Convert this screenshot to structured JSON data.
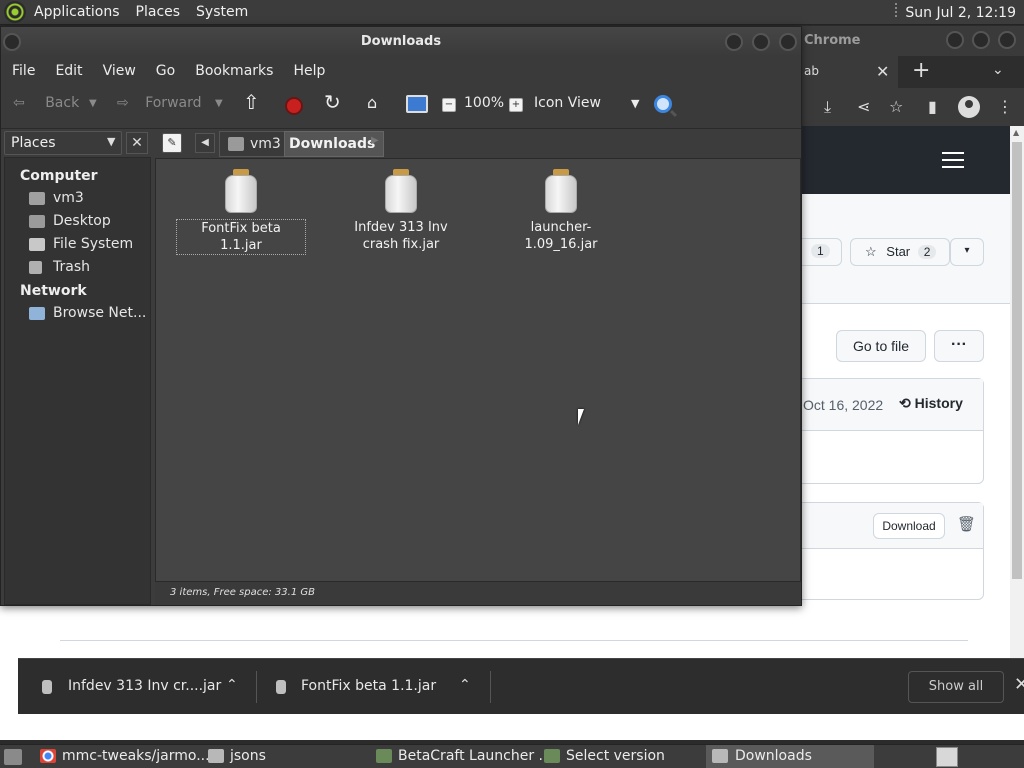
{
  "top_panel": {
    "menus": [
      "Applications",
      "Places",
      "System"
    ],
    "clock": "Sun Jul  2, 12:19"
  },
  "browser": {
    "title": "Chrome",
    "tab_label": "ab",
    "repo": {
      "watch_count": "1",
      "star_label": "Star",
      "star_count": "2",
      "go_to_file": "Go to file",
      "more": "···",
      "commit_date": "Oct 16, 2022",
      "history": "History",
      "download": "Download"
    },
    "downloads": [
      {
        "name": "Infdev 313 Inv cr....jar"
      },
      {
        "name": "FontFix beta 1.1.jar"
      }
    ],
    "show_all": "Show all"
  },
  "file_manager": {
    "title": "Downloads",
    "menu": [
      "File",
      "Edit",
      "View",
      "Go",
      "Bookmarks",
      "Help"
    ],
    "toolbar": {
      "back": "Back",
      "forward": "Forward",
      "zoom": "100%",
      "view_mode": "Icon View"
    },
    "sidebar_select": "Places",
    "sidebar": {
      "computer_heading": "Computer",
      "computer_items": [
        "vm3",
        "Desktop",
        "File System",
        "Trash"
      ],
      "network_heading": "Network",
      "network_items": [
        "Browse Net..."
      ]
    },
    "path": [
      "vm3",
      "Downloads"
    ],
    "files": [
      {
        "name": "FontFix beta 1.1.jar"
      },
      {
        "name": "Infdev 313 Inv crash fix.jar"
      },
      {
        "name": "launcher-1.09_16.jar"
      }
    ],
    "status": "3 items, Free space: 33.1 GB"
  },
  "taskbar": {
    "tasks": [
      "mmc-tweaks/jarmo...",
      "jsons",
      "BetaCraft Launcher ...",
      "Select version",
      "Downloads"
    ]
  },
  "colors": {
    "panel": "#3c3c3c",
    "window": "#3c3c3c",
    "content": "#454545",
    "accent": "#3c86e0",
    "stop": "#c8201e"
  }
}
